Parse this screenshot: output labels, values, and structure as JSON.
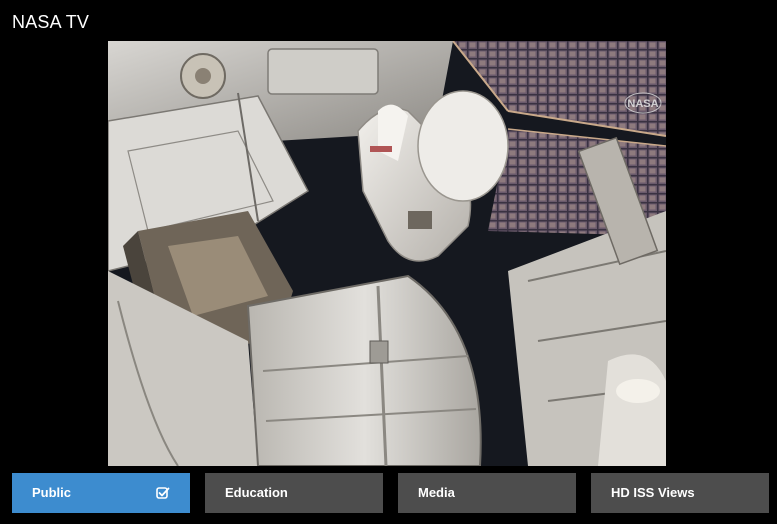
{
  "header": {
    "title": "NASA TV"
  },
  "video": {
    "watermark_icon": "nasa-logo-icon",
    "content": "iss-spacewalk-feed"
  },
  "channels": [
    {
      "label": "Public",
      "selected": true
    },
    {
      "label": "Education",
      "selected": false
    },
    {
      "label": "Media",
      "selected": false
    },
    {
      "label": "HD ISS Views",
      "selected": false
    }
  ],
  "colors": {
    "background": "#000000",
    "tab_active": "#3d8ccf",
    "tab_inactive": "#4d4d4d",
    "text": "#ffffff"
  },
  "icons": {
    "selected_indicator": "check-icon"
  }
}
